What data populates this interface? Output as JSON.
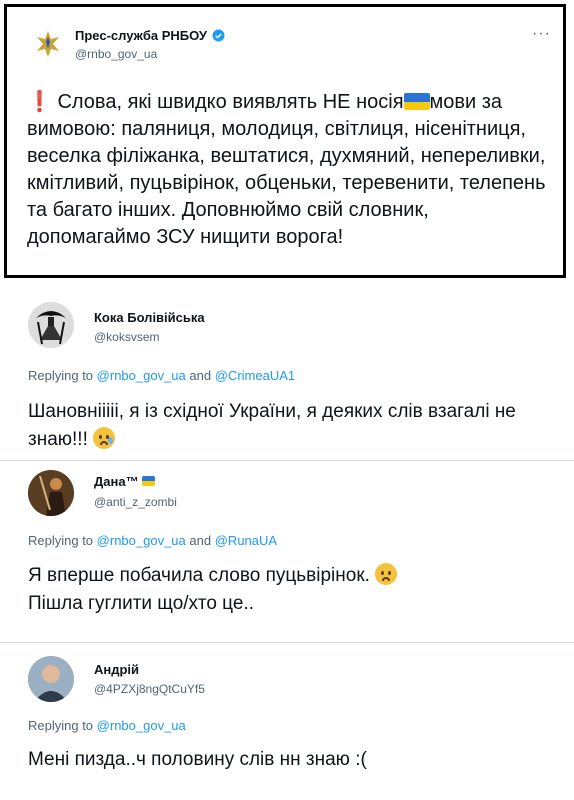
{
  "main_tweet": {
    "name": "Прес-служба РНБОУ",
    "handle": "@rnbo_gov_ua",
    "more_label": "···",
    "text_part1": "Слова, які швидко виявлять НЕ носія",
    "text_part2": "мови за вимовою:",
    "text_part3": "паляниця, молодиця, світлиця, нісенітниця, веселка філіжанка, вештатися, духмяний, непереливки, кмітливий, пуцьвірінок, обценьки, теревенити, телепень та багато інших. Доповнюймо свій словник, допомагаймо ЗСУ нищити ворога!"
  },
  "replies": [
    {
      "name": "Кока Болівійська",
      "handle": "@koksvsem",
      "replying_prefix": "Replying to",
      "mention1": "@rnbo_gov_ua",
      "and_word": "and",
      "mention2": "@CrimeaUA1",
      "text": "Шановнііііі, я із східної України, я деяких слів взагалі не знаю!!!"
    },
    {
      "name": "Дана™",
      "handle": "@anti_z_zombi",
      "replying_prefix": "Replying to",
      "mention1": "@rnbo_gov_ua",
      "and_word": "and",
      "mention2": "@RunaUA",
      "text_line1": "Я вперше побачила слово пуцьвірінок.",
      "text_line2": "Пішла гуглити що/хто це.."
    },
    {
      "name": "Андрій",
      "handle": "@4PZXj8ngQtCuYf5",
      "replying_prefix": "Replying to",
      "mention1": "@rnbo_gov_ua",
      "text": "Мені пизда..ч половину слів нн знаю :("
    }
  ],
  "colors": {
    "link": "#1d9bf0",
    "muted": "#536471",
    "flag_blue": "#2a74d8",
    "flag_yellow": "#f6c90e"
  }
}
